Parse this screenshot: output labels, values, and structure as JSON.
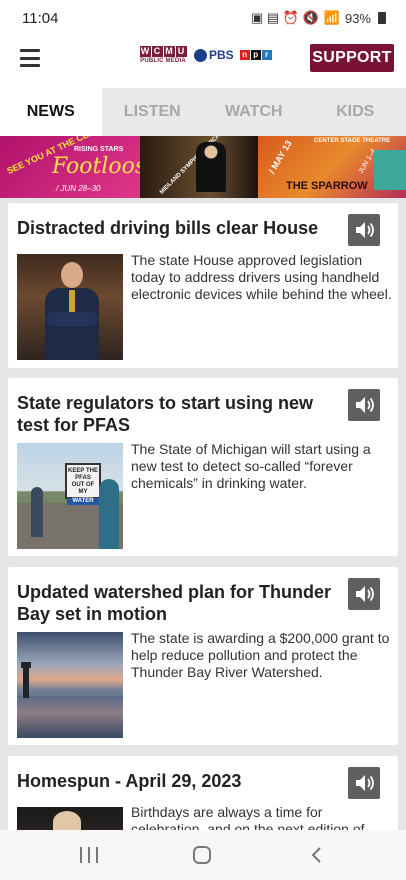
{
  "status_bar": {
    "time": "11:04",
    "signal_text": "",
    "battery": "93%"
  },
  "header": {
    "logo": {
      "letters": [
        "W",
        "C",
        "M",
        "U"
      ],
      "sub": "PUBLIC MEDIA",
      "pbs": "PBS",
      "npr": [
        "n",
        "p",
        "r"
      ]
    },
    "support_label": "SUPPORT"
  },
  "tabs": [
    {
      "label": "NEWS",
      "active": true
    },
    {
      "label": "LISTEN",
      "active": false
    },
    {
      "label": "WATCH",
      "active": false
    },
    {
      "label": "KIDS",
      "active": false
    }
  ],
  "banner": {
    "see_you": "SEE YOU AT THE CENTER!",
    "rising_stars": "RISING STARS",
    "footloose": "Footloose",
    "footloose_dates": "/ JUN 28–30",
    "orchestra": "MIDLAND SYMPHONY ORCHESTRA",
    "may": "/ MAY 13",
    "center_stage": "CENTER STAGE THEATRE",
    "sparrow": "THE SPARROW",
    "jun": "JUN 1–4",
    "midland_center": "MIDLAND CENTER FOR THE ARTS"
  },
  "articles": [
    {
      "title": "Distracted driving bills clear House",
      "summary": "The state House approved legislation today to address drivers using handheld electronic devices while behind the wheel."
    },
    {
      "title": "State regulators to start using new test for PFAS",
      "summary": "The State of Michigan will start using a new test to detect so-called “forever chemicals” in drinking water.",
      "sign_text": [
        "KEEP THE",
        "PFAS",
        "OUT OF MY",
        "WATER"
      ]
    },
    {
      "title": "Updated watershed plan for Thunder Bay set in motion",
      "summary": "The state is awarding a $200,000 grant to help reduce pollution and protect the Thunder Bay River Watershed."
    },
    {
      "title": "Homespun - April 29, 2023",
      "summary": "Birthdays are always a time for celebration, and on the next edition of"
    }
  ],
  "colors": {
    "brand": "#7a1237",
    "tab_inactive": "#a8a8a8",
    "audio_button": "#5f5f5f"
  },
  "icons": {
    "menu": "hamburger-menu-icon",
    "audio": "speaker-icon",
    "nav_recents": "recents-icon",
    "nav_home": "home-icon",
    "nav_back": "back-icon"
  }
}
